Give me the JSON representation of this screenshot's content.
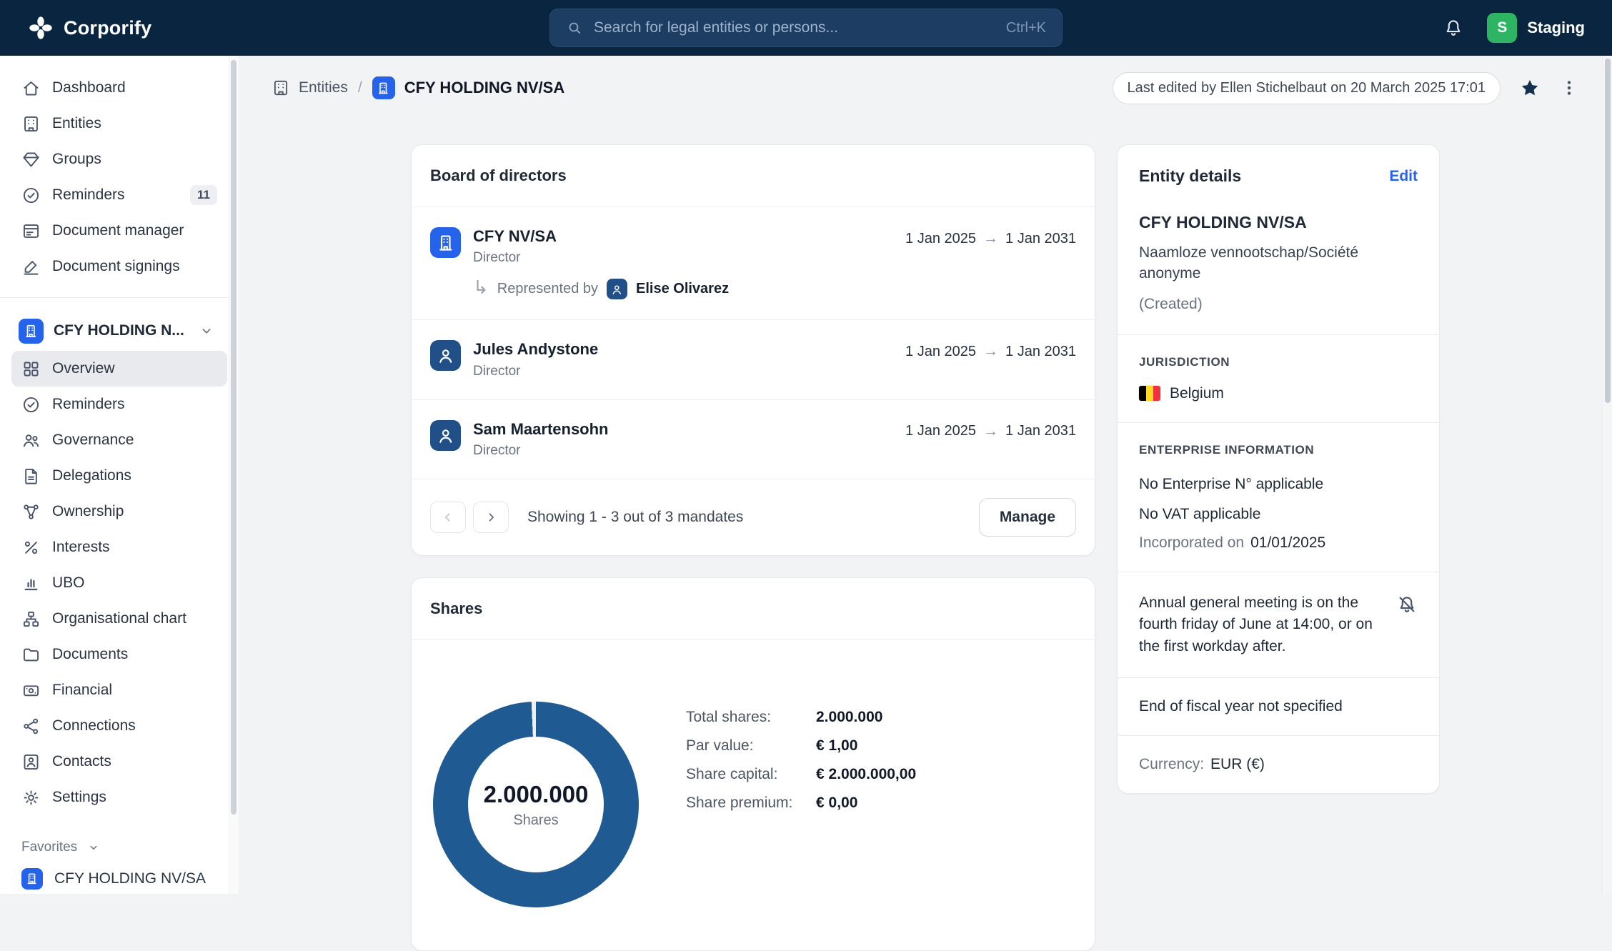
{
  "topbar": {
    "brand": "Corporify",
    "search_placeholder": "Search for legal entities or persons...",
    "shortcut": "Ctrl+K",
    "avatar_initial": "S",
    "environment": "Staging"
  },
  "sidebar": {
    "global": [
      {
        "label": "Dashboard"
      },
      {
        "label": "Entities"
      },
      {
        "label": "Groups"
      },
      {
        "label": "Reminders",
        "badge": "11"
      },
      {
        "label": "Document manager"
      },
      {
        "label": "Document signings"
      }
    ],
    "entity_selector": {
      "name": "CFY HOLDING N..."
    },
    "entity_nav": [
      {
        "label": "Overview"
      },
      {
        "label": "Reminders"
      },
      {
        "label": "Governance"
      },
      {
        "label": "Delegations"
      },
      {
        "label": "Ownership"
      },
      {
        "label": "Interests"
      },
      {
        "label": "UBO"
      },
      {
        "label": "Organisational chart"
      },
      {
        "label": "Documents"
      },
      {
        "label": "Financial"
      },
      {
        "label": "Connections"
      },
      {
        "label": "Contacts"
      },
      {
        "label": "Settings"
      }
    ],
    "favorites_label": "Favorites",
    "favorites": [
      {
        "label": "CFY HOLDING NV/SA"
      }
    ]
  },
  "breadcrumb": {
    "root": "Entities",
    "separator": "/",
    "current": "CFY HOLDING NV/SA"
  },
  "page_meta": {
    "last_edited": "Last edited by Ellen Stichelbaut on 20 March 2025 17:01"
  },
  "board": {
    "title": "Board of directors",
    "range_arrow": "→",
    "rep_arrow_glyph": "↳",
    "mandates": [
      {
        "name": "CFY NV/SA",
        "role": "Director",
        "start": "1 Jan 2025",
        "end": "1 Jan 2031",
        "represented_by_label": "Represented by",
        "representative": "Elise Olivarez"
      },
      {
        "name": "Jules Andystone",
        "role": "Director",
        "start": "1 Jan 2025",
        "end": "1 Jan 2031"
      },
      {
        "name": "Sam Maartensohn",
        "role": "Director",
        "start": "1 Jan 2025",
        "end": "1 Jan 2031"
      }
    ],
    "footer": {
      "showing": "Showing 1 - 3 out of 3 mandates",
      "manage_label": "Manage"
    }
  },
  "shares": {
    "title": "Shares",
    "donut": {
      "value": "2.000.000",
      "label": "Shares",
      "color": "#1F5A92",
      "percent_filled": 100
    },
    "stats": [
      {
        "label": "Total shares:",
        "value": "2.000.000"
      },
      {
        "label": "Par value:",
        "value": "€ 1,00"
      },
      {
        "label": "Share capital:",
        "value": "€ 2.000.000,00"
      },
      {
        "label": "Share premium:",
        "value": "€ 0,00"
      }
    ]
  },
  "entity_details": {
    "title": "Entity details",
    "edit_label": "Edit",
    "name": "CFY HOLDING NV/SA",
    "legal_form": "Naamloze vennootschap/Société anonyme",
    "status": "(Created)",
    "jurisdiction_heading": "JURISDICTION",
    "jurisdiction": "Belgium",
    "enterprise_heading": "ENTERPRISE INFORMATION",
    "enterprise_line1": "No Enterprise N° applicable",
    "enterprise_line2": "No VAT applicable",
    "incorporated_label": "Incorporated on",
    "incorporated_date": "01/01/2025",
    "agm_text": "Annual general meeting is on the fourth friday of June at 14:00, or on the first workday after.",
    "fiscal_year_text": "End of fiscal year not specified",
    "currency_label": "Currency:",
    "currency_value": "EUR (€)"
  },
  "colors": {
    "topbar_bg": "#0A2540",
    "accent_blue": "#2563EB",
    "entity_icon_blue": "#2563EB",
    "person_icon_navy": "#215089",
    "donut_blue": "#1F5A92",
    "avatar_green": "#2DB563",
    "flag_black": "#000000",
    "flag_yellow": "#FDDA25",
    "flag_red": "#EF3340"
  }
}
